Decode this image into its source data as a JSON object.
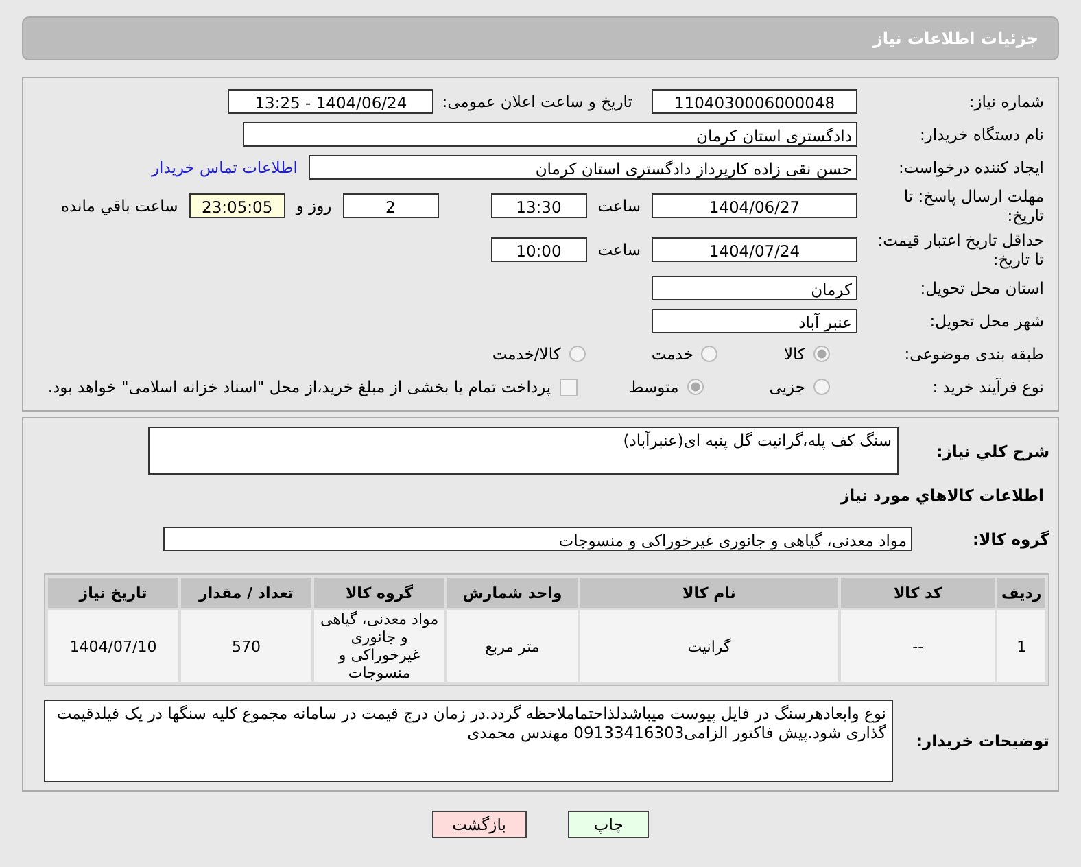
{
  "header": {
    "title": "جزئیات اطلاعات نیاز"
  },
  "need_number": {
    "label": "شماره نیاز:",
    "value": "1104030006000048"
  },
  "announcement": {
    "label": "تاریخ و ساعت اعلان عمومی:",
    "value": "1404/06/24 - 13:25"
  },
  "buyer_org": {
    "label": "نام دستگاه خریدار:",
    "value": "دادگستری استان کرمان"
  },
  "requester": {
    "label": "ایجاد کننده درخواست:",
    "value": "حسن نقی زاده کارپرداز دادگستری استان کرمان",
    "link": "اطلاعات تماس خریدار"
  },
  "reply_deadline": {
    "label": "مهلت ارسال پاسخ: تا تاریخ:",
    "date": "1404/06/27",
    "time_label": "ساعت",
    "time": "13:30",
    "days": "2",
    "days_label": "روز و",
    "remaining": "23:05:05",
    "remaining_label": "ساعت باقي مانده"
  },
  "price_validity": {
    "label": "حداقل تاریخ اعتبار قیمت: تا تاریخ:",
    "date": "1404/07/24",
    "time_label": "ساعت",
    "time": "10:00"
  },
  "province": {
    "label": "استان محل تحویل:",
    "value": "کرمان"
  },
  "city": {
    "label": "شهر محل تحویل:",
    "value": "عنبر آباد"
  },
  "category": {
    "label": "طبقه بندی موضوعی:",
    "options": [
      {
        "label": "کالا",
        "selected": true
      },
      {
        "label": "خدمت",
        "selected": false
      },
      {
        "label": "کالا/خدمت",
        "selected": false
      }
    ]
  },
  "purchase_type": {
    "label": "نوع فرآیند خرید :",
    "options": [
      {
        "label": "جزیی",
        "selected": false
      },
      {
        "label": "متوسط",
        "selected": true
      }
    ],
    "treasury": {
      "checked": false,
      "text": "پرداخت تمام یا بخشی از مبلغ خرید،از محل \"اسناد خزانه اسلامی\" خواهد بود."
    }
  },
  "description": {
    "label": "شرح کلي نياز:",
    "value": "سنگ کف پله،گرانیت گل پنبه ای(عنبرآباد)"
  },
  "goods_title": "اطلاعات کالاهاي مورد نياز",
  "goods_group": {
    "label": "گروه کالا:",
    "value": "مواد معدنی، گیاهی و جانوری غیرخوراکی و منسوجات"
  },
  "table": {
    "columns": [
      "ردیف",
      "کد کالا",
      "نام کالا",
      "واحد شمارش",
      "گروه کالا",
      "تعداد / مقدار",
      "تاریخ نیاز"
    ],
    "rows": [
      [
        "1",
        "--",
        "گرانیت",
        "متر مربع",
        "مواد معدنی، گیاهی و جانوری غیرخوراکی و منسوجات",
        "570",
        "1404/07/10"
      ]
    ]
  },
  "notes": {
    "label": "توضیحات خریدار:",
    "value": "نوع وابعادهرسنگ در فایل پیوست میباشدلذاحتماملاحظه گردد.در زمان درج قیمت در سامانه مجموع کلیه سنگها در یک فیلدقیمت گذاری شود.پیش فاکتور الزامی09133416303 مهندس محمدی"
  },
  "buttons": [
    {
      "label": "چاپ",
      "kind": "print"
    },
    {
      "label": "بازگشت",
      "kind": "back"
    }
  ]
}
